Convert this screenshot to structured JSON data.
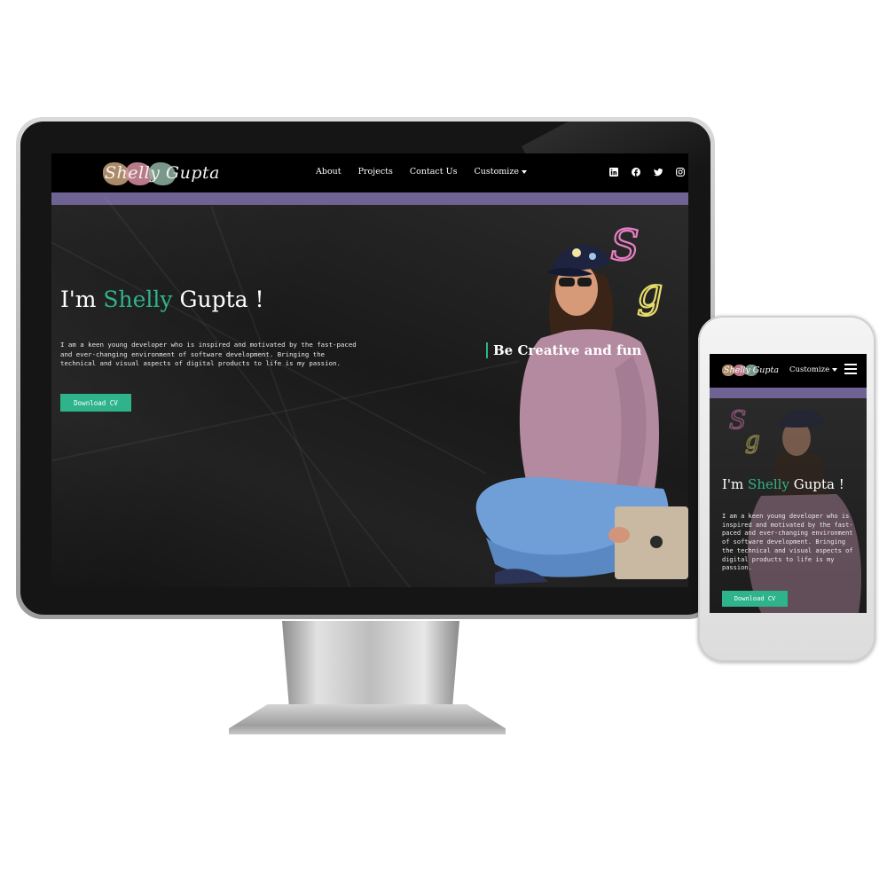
{
  "brand": {
    "name": "Shelly Gupta"
  },
  "nav": {
    "links": [
      "About",
      "Projects",
      "Contact Us"
    ],
    "customize": "Customize"
  },
  "socials": [
    "linkedin-icon",
    "facebook-icon",
    "twitter-icon",
    "instagram-icon"
  ],
  "hero": {
    "title_prefix": "I'm ",
    "title_accent": "Shelly",
    "title_suffix": " Gupta !",
    "description": "I am a keen young developer who is inspired and motivated by the fast-paced and ever-changing environment of software development. Bringing the technical and visual aspects of digital products to life is my passion.",
    "button": "Download CV",
    "tagline": "Be Creative and fun",
    "neon_initials": "Sg"
  },
  "mobile": {
    "customize": "Customize",
    "title_prefix": "I'm ",
    "title_accent": "Shelly",
    "title_suffix": " Gupta !",
    "description": "I am a keen young developer who is inspired and motivated by the fast-paced and ever-changing environment of software development. Bringing the technical and visual aspects of digital products to life is my passion.",
    "button": "Download CV"
  },
  "colors": {
    "accent": "#2fb38b",
    "band": "#6e6393",
    "nav_bg": "#000000"
  }
}
